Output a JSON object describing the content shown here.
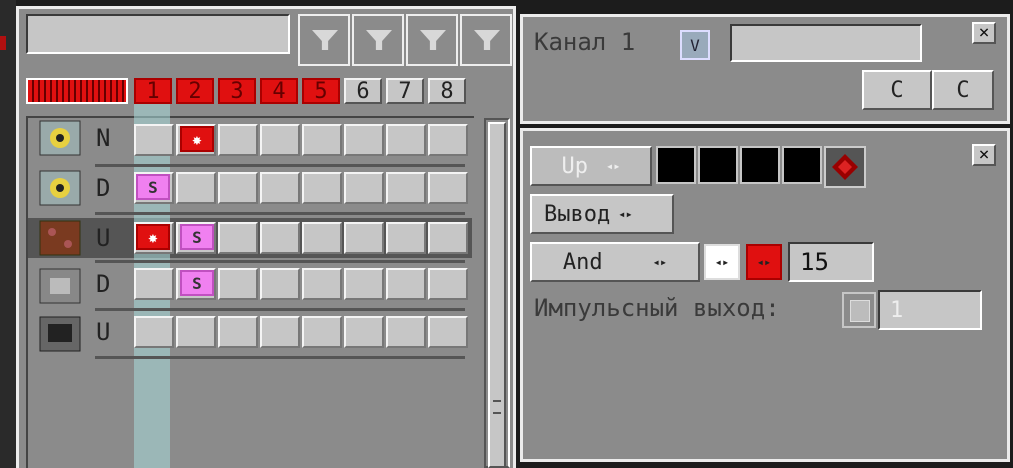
{
  "search": {
    "value": ""
  },
  "filter_buttons": [
    "filter",
    "filter",
    "filter",
    "filter"
  ],
  "tabs": [
    {
      "label": "1",
      "color": "#e01010"
    },
    {
      "label": "2",
      "color": "#e01010"
    },
    {
      "label": "3",
      "color": "#e01010"
    },
    {
      "label": "4",
      "color": "#e01010"
    },
    {
      "label": "5",
      "color": "#e01010"
    },
    {
      "label": "6",
      "color": "#c6c6c6"
    },
    {
      "label": "7",
      "color": "#c6c6c6"
    },
    {
      "label": "8",
      "color": "#c6c6c6"
    }
  ],
  "rows": [
    {
      "icon": "reactor-icon",
      "mode": "N",
      "marks": [
        "",
        "star"
      ]
    },
    {
      "icon": "reactor-icon",
      "mode": "D",
      "marks": [
        "s",
        ""
      ]
    },
    {
      "icon": "redstone-lamp-icon",
      "mode": "U",
      "marks": [
        "star",
        "s"
      ]
    },
    {
      "icon": "machine-icon",
      "mode": "D",
      "marks": [
        "",
        "s"
      ]
    },
    {
      "icon": "computer-icon",
      "mode": "U",
      "marks": [
        "",
        ""
      ]
    }
  ],
  "channel": {
    "label": "Канал 1",
    "toggle": "V",
    "name_value": "",
    "btn_c1": "C",
    "btn_c2": "C",
    "close": "×"
  },
  "config": {
    "close": "×",
    "up_label": "Up",
    "output_label": "Вывод",
    "and_label": "And",
    "value": "15",
    "impulse_label": "Импульсный выход:",
    "impulse_value": "1"
  },
  "colors": {
    "accent_red": "#e01010",
    "signal_pink": "#f080f0",
    "panel": "#8b8b8b",
    "slot": "#c6c6c6"
  }
}
